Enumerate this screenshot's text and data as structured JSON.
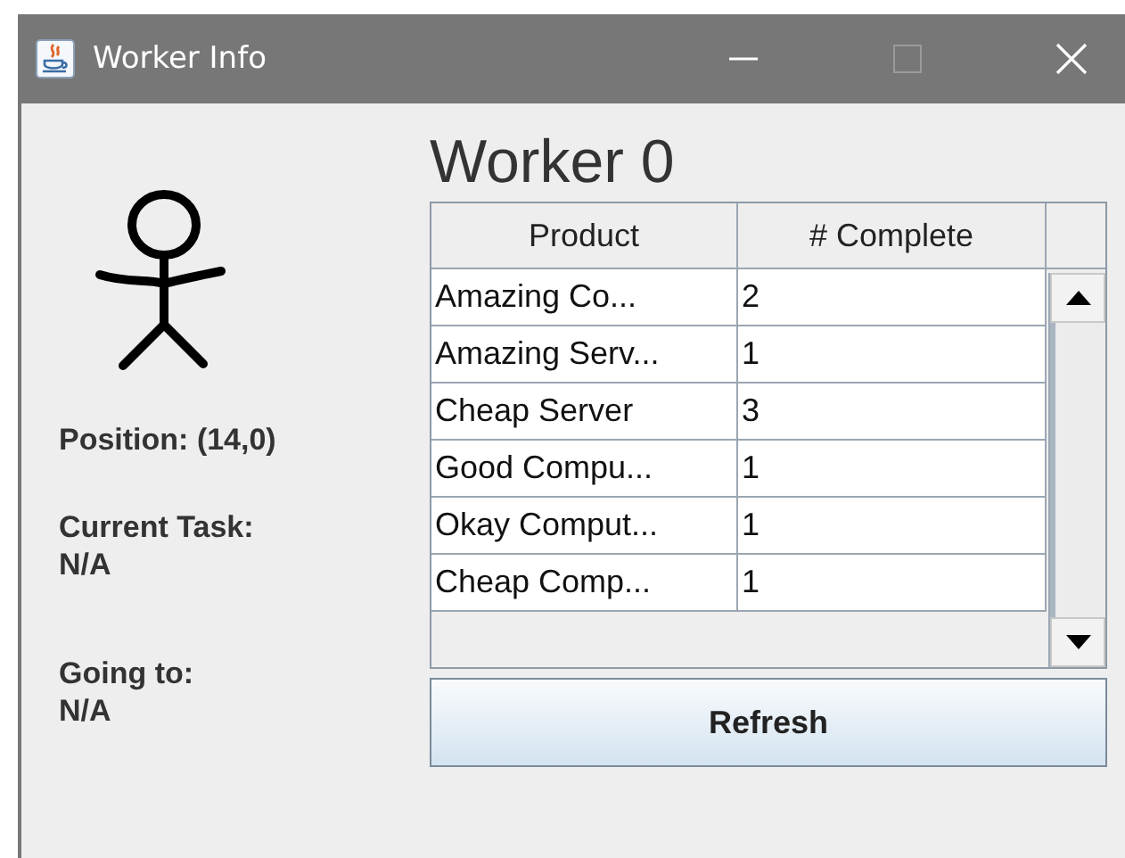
{
  "window": {
    "title": "Worker Info"
  },
  "worker": {
    "position": "Position: (14,0)",
    "task_label": "Current Task:",
    "task_value": "N/A",
    "going_label": "Going to:",
    "going_value": "N/A"
  },
  "heading": "Worker 0",
  "table": {
    "columns": [
      "Product",
      "# Complete"
    ],
    "rows": [
      [
        "Amazing Co...",
        "2"
      ],
      [
        "Amazing Serv...",
        "1"
      ],
      [
        "Cheap Server",
        "3"
      ],
      [
        "Good Compu...",
        "1"
      ],
      [
        "Okay Comput...",
        "1"
      ],
      [
        "Cheap Comp...",
        "1"
      ]
    ]
  },
  "buttons": [
    "Refresh"
  ]
}
